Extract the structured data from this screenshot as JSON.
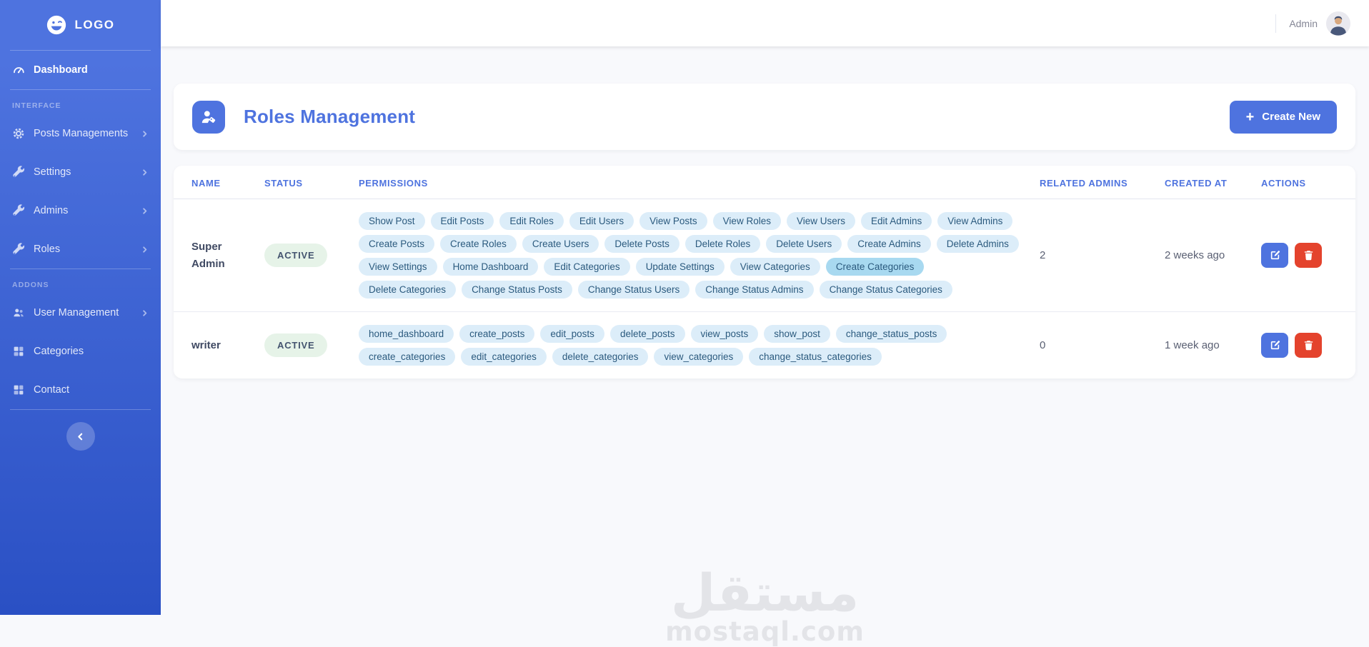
{
  "topbar": {
    "user_label": "Admin"
  },
  "sidebar": {
    "logo_text": "LOGO",
    "logo_icon": "laugh-wink-icon",
    "items": [
      {
        "type": "link",
        "label": "Dashboard",
        "icon": "tachometer-icon",
        "active": true,
        "chevron": false
      },
      {
        "type": "divider"
      },
      {
        "type": "section",
        "label": "INTERFACE"
      },
      {
        "type": "link",
        "label": "Posts Managements",
        "icon": "gear-icon",
        "chevron": true
      },
      {
        "type": "link",
        "label": "Settings",
        "icon": "wrench-icon",
        "chevron": true
      },
      {
        "type": "link",
        "label": "Admins",
        "icon": "wrench-icon",
        "chevron": true
      },
      {
        "type": "link",
        "label": "Roles",
        "icon": "wrench-icon",
        "chevron": true
      },
      {
        "type": "divider"
      },
      {
        "type": "section",
        "label": "ADDONS"
      },
      {
        "type": "link",
        "label": "User Management",
        "icon": "users-icon",
        "chevron": true
      },
      {
        "type": "link",
        "label": "Categories",
        "icon": "grid-icon",
        "chevron": false
      },
      {
        "type": "link",
        "label": "Contact",
        "icon": "grid-icon",
        "chevron": false
      }
    ],
    "collapse_icon": "chevron-left-icon"
  },
  "page": {
    "title": "Roles Management",
    "title_icon": "user-tag-icon",
    "create_button": "Create New"
  },
  "table": {
    "headers": [
      {
        "id": "name",
        "label": "NAME"
      },
      {
        "id": "status",
        "label": "STATUS"
      },
      {
        "id": "permissions",
        "label": "PERMISSIONS"
      },
      {
        "id": "related-admins",
        "label": "RELATED ADMINS"
      },
      {
        "id": "created-at",
        "label": "CREATED AT"
      },
      {
        "id": "actions",
        "label": "ACTIONS"
      }
    ],
    "rows": [
      {
        "name": "Super Admin",
        "status": "ACTIVE",
        "permissions": [
          "Show Post",
          "Edit Posts",
          "Edit Roles",
          "Edit Users",
          "View Posts",
          "View Roles",
          "View Users",
          "Edit Admins",
          "View Admins",
          "Create Posts",
          "Create Roles",
          "Create Users",
          "Delete Posts",
          "Delete Roles",
          "Delete Users",
          "Create Admins",
          "Delete Admins",
          "View Settings",
          "Home Dashboard",
          "Edit Categories",
          "Update Settings",
          "View Categories",
          "Create Categories",
          "Delete Categories",
          "Change Status Posts",
          "Change Status Users",
          "Change Status Admins",
          "Change Status Categories"
        ],
        "highlighted_permission": "Create Categories",
        "related_admins": "2",
        "created_at": "2 weeks ago"
      },
      {
        "name": "writer",
        "status": "ACTIVE",
        "permissions": [
          "home_dashboard",
          "create_posts",
          "edit_posts",
          "delete_posts",
          "view_posts",
          "show_post",
          "change_status_posts",
          "create_categories",
          "edit_categories",
          "delete_categories",
          "view_categories",
          "change_status_categories"
        ],
        "highlighted_permission": "",
        "related_admins": "0",
        "created_at": "1 week ago"
      }
    ]
  },
  "watermark": {
    "arabic": "مستقل",
    "latin": "mostaql.com"
  },
  "colors": {
    "accent": "#4e73df",
    "sidebar_gradient_top": "#4e73df",
    "sidebar_gradient_bottom": "#2a50c4",
    "danger": "#e4432d",
    "pill_bg": "#dcedf9",
    "pill_bg_highlight": "#a8d9f0",
    "pill_text": "#2b5a7e",
    "status_active_bg": "#e6f3e8",
    "status_active_text": "#44546f",
    "content_bg": "#f8f9fc",
    "watermark_gray": "#e3e4e8"
  }
}
